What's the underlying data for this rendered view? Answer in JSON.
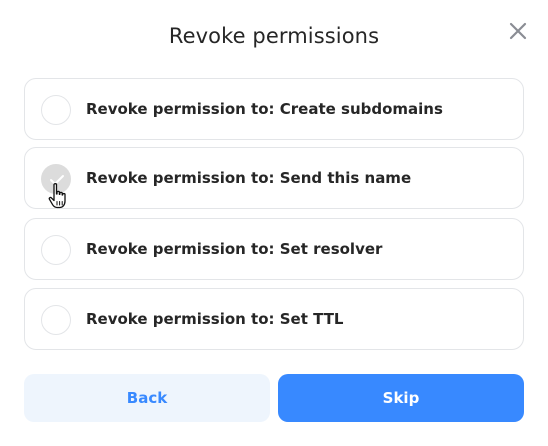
{
  "dialog": {
    "title": "Revoke permissions",
    "close_icon": "close-icon"
  },
  "options": [
    {
      "label": "Revoke permission to: Create subdomains",
      "state": "default"
    },
    {
      "label": "Revoke permission to: Send this name",
      "state": "hover"
    },
    {
      "label": "Revoke permission to: Set resolver",
      "state": "default"
    },
    {
      "label": "Revoke permission to: Set TTL",
      "state": "default"
    }
  ],
  "buttons": {
    "back_label": "Back",
    "skip_label": "Skip"
  },
  "colors": {
    "accent": "#3889ff",
    "back_background": "#eef5fd",
    "border": "#e3e5e8",
    "title_text": "#262626"
  },
  "cursor_icon": "hand-pointer-icon"
}
